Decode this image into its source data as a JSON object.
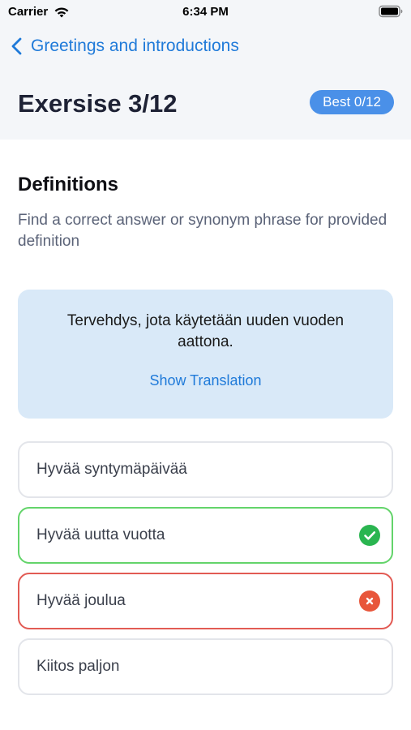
{
  "status_bar": {
    "carrier": "Carrier",
    "time": "6:34 PM"
  },
  "nav": {
    "back_label": "Greetings and introductions"
  },
  "header": {
    "title": "Exersise 3/12",
    "best_badge": "Best 0/12"
  },
  "section": {
    "title": "Definitions",
    "description": "Find a correct answer or synonym phrase for provided definition"
  },
  "question": {
    "text": "Tervehdys, jota käytetään uuden vuoden aattona.",
    "show_translation": "Show Translation"
  },
  "options": [
    {
      "label": "Hyvää syntymäpäivää",
      "state": "neutral"
    },
    {
      "label": "Hyvää uutta vuotta",
      "state": "correct"
    },
    {
      "label": "Hyvää joulua",
      "state": "wrong"
    },
    {
      "label": "Kiitos paljon",
      "state": "neutral"
    }
  ],
  "colors": {
    "accent": "#1f7ad9",
    "badge": "#4a90e8",
    "card": "#d9e9f8",
    "correct": "#2ab550",
    "wrong": "#e8563b"
  }
}
